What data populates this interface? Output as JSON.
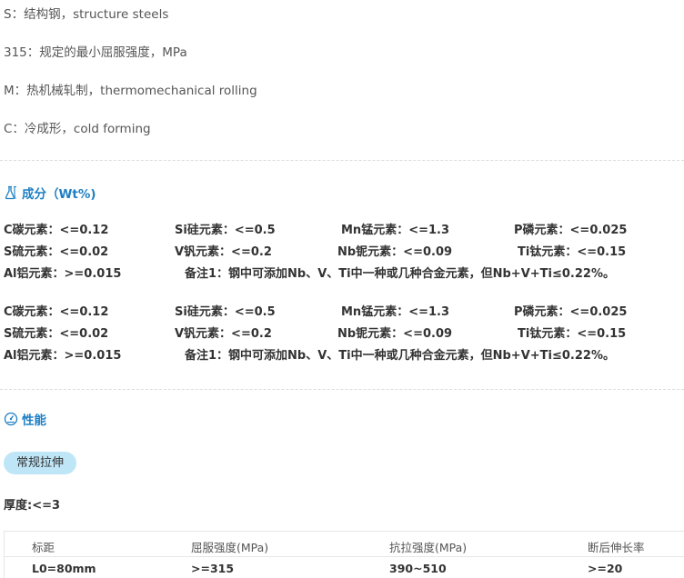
{
  "descriptions": [
    "S：结构钢，structure steels",
    "315：规定的最小屈服强度，MPa",
    "M：热机械轧制，thermomechanical rolling",
    "C：冷成形，cold forming"
  ],
  "composition": {
    "title": "成分（Wt%)",
    "groups": [
      {
        "rows": [
          [
            "C碳元素：<=0.12",
            "Si硅元素：<=0.5",
            "Mn锰元素：<=1.3",
            "P磷元素：<=0.025"
          ],
          [
            "S硫元素：<=0.02",
            "V钒元素：<=0.2",
            "Nb铌元素：<=0.09",
            "Ti钛元素：<=0.15"
          ]
        ],
        "last_row": [
          "Al铝元素：>=0.015",
          "备注1：钢中可添加Nb、V、Ti中一种或几种合金元素，但Nb+V+Ti≤0.22%。"
        ]
      },
      {
        "rows": [
          [
            "C碳元素：<=0.12",
            "Si硅元素：<=0.5",
            "Mn锰元素：<=1.3",
            "P磷元素：<=0.025"
          ],
          [
            "S硫元素：<=0.02",
            "V钒元素：<=0.2",
            "Nb铌元素：<=0.09",
            "Ti钛元素：<=0.15"
          ]
        ],
        "last_row": [
          "Al铝元素：>=0.015",
          "备注1：钢中可添加Nb、V、Ti中一种或几种合金元素，但Nb+V+Ti≤0.22%。"
        ]
      }
    ]
  },
  "performance": {
    "title": "性能",
    "tab_label": "常规拉伸",
    "thickness": "厚度:<=3",
    "table": {
      "headers": [
        "标距",
        "屈服强度(MPa)",
        "抗拉强度(MPa)",
        "断后伸长率"
      ],
      "rows": [
        [
          "L0=80mm",
          ">=315",
          "390~510",
          ">=20"
        ]
      ]
    }
  },
  "colors": {
    "accent": "#1e7fc4",
    "pill": "#bfe6f7"
  }
}
